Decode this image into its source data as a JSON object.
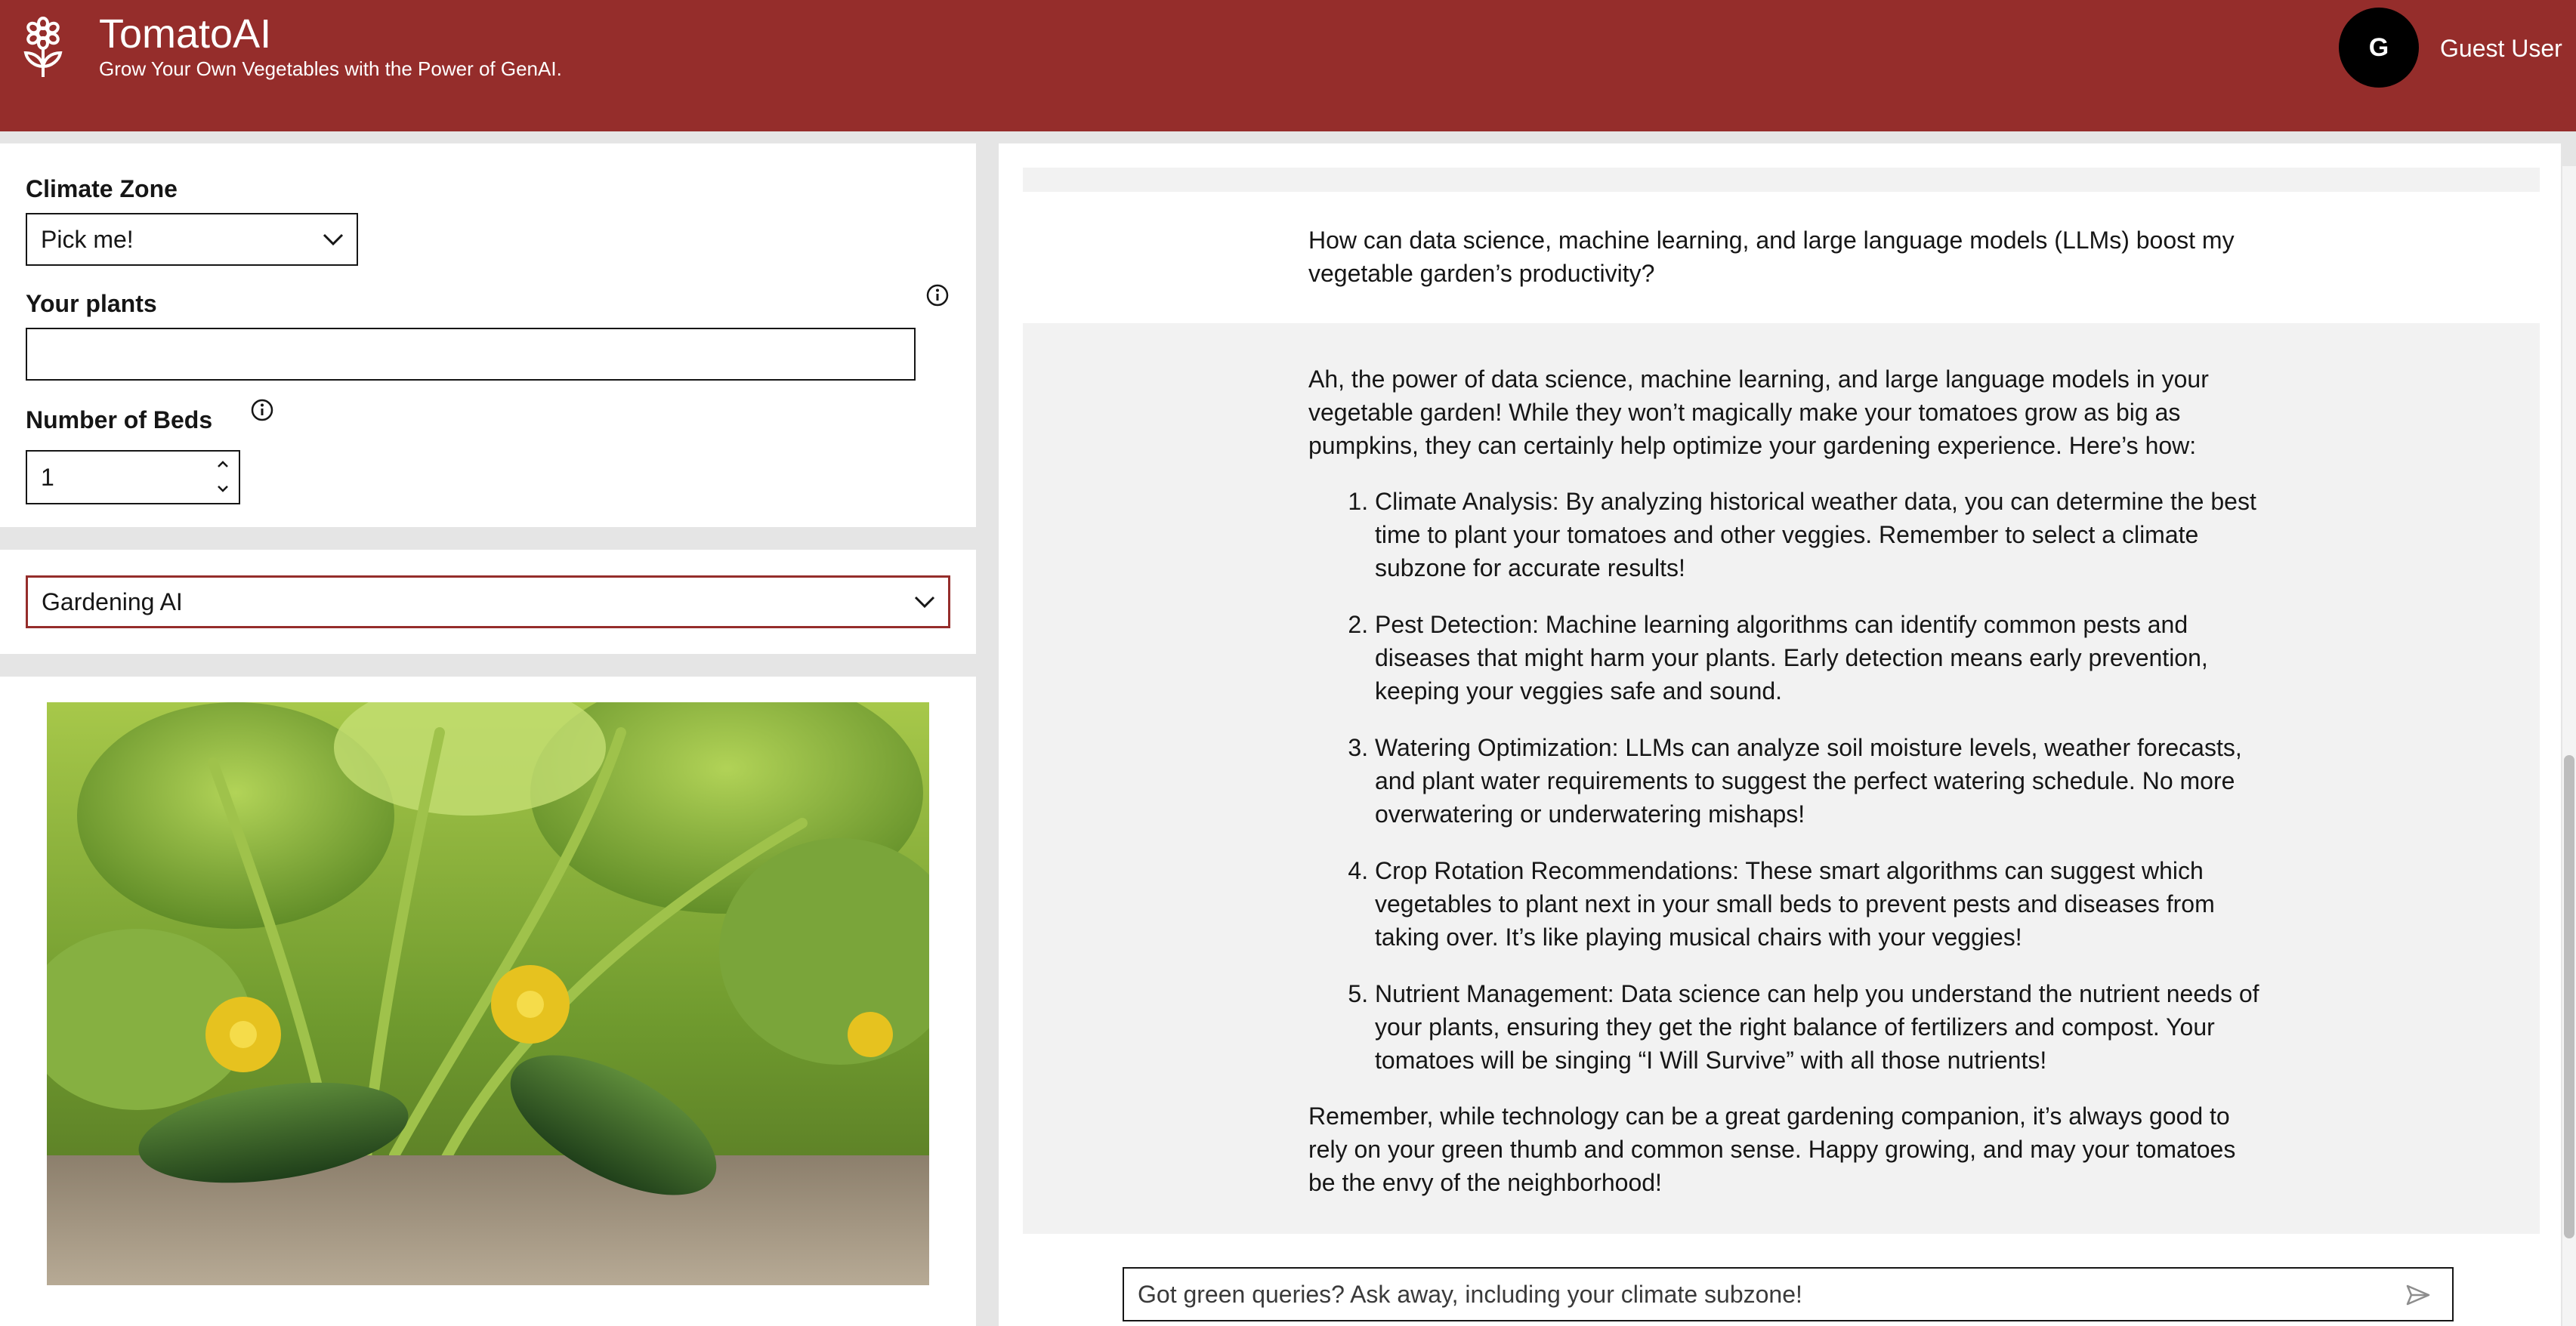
{
  "header": {
    "app_title": "TomatoAI",
    "app_subtitle": "Grow Your Own Vegetables with the Power of GenAI.",
    "avatar_initial": "G",
    "user_name": "Guest User",
    "logo_icon": "flower-icon"
  },
  "settings": {
    "climate_zone_label": "Climate Zone",
    "climate_zone_value": "Pick me!",
    "plants_label": "Your plants",
    "plants_value": "",
    "beds_label": "Number of Beds",
    "beds_value": "1"
  },
  "model_select": {
    "value": "Gardening AI"
  },
  "image": {
    "subject": "cucumber plants with yellow flowers"
  },
  "chat": {
    "user_message": "How can data science, machine learning, and large language models (LLMs) boost my vegetable garden’s productivity?",
    "ai_intro": "Ah, the power of data science, machine learning, and large language models in your vegetable garden! While they won’t magically make your tomatoes grow as big as pumpkins, they can certainly help optimize your gardening experience. Here’s how:",
    "ai_points": [
      "Climate Analysis: By analyzing historical weather data, you can determine the best time to plant your tomatoes and other veggies. Remember to select a climate subzone for accurate results!",
      "Pest Detection: Machine learning algorithms can identify common pests and diseases that might harm your plants. Early detection means early prevention, keeping your veggies safe and sound.",
      "Watering Optimization: LLMs can analyze soil moisture levels, weather forecasts, and plant water requirements to suggest the perfect watering schedule. No more overwatering or underwatering mishaps!",
      "Crop Rotation Recommendations: These smart algorithms can suggest which vegetables to plant next in your small beds to prevent pests and diseases from taking over. It’s like playing musical chairs with your veggies!",
      "Nutrient Management: Data science can help you understand the nutrient needs of your plants, ensuring they get the right balance of fertilizers and compost. Your tomatoes will be singing “I Will Survive” with all those nutrients!"
    ],
    "ai_outro": "Remember, while technology can be a great gardening companion, it’s always good to rely on your green thumb and common sense. Happy growing, and may your tomatoes be the envy of the neighborhood!",
    "input_placeholder": "Got green queries? Ask away, including your climate subzone!"
  },
  "colors": {
    "brand": "#952d2b",
    "panel_bg": "#ffffff",
    "page_bg": "#e5e5e5",
    "message_bg": "#f2f2f2"
  }
}
